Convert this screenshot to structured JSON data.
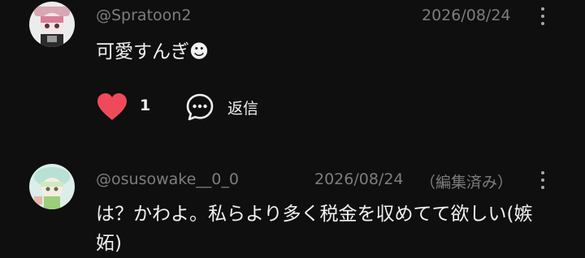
{
  "comments": [
    {
      "handle": "@Spratoon2",
      "date": "2026/08/24",
      "text": "可愛すんぎ☻",
      "like_icon": "heart-icon",
      "like_count": "1",
      "reply_icon": "speech-bubble-icon",
      "reply_label": "返信",
      "more_icon": "more-vertical-icon"
    },
    {
      "handle": "@osusowake__0_0",
      "date": "2026/08/24",
      "edited": "（編集済み）",
      "text": "は？かわよ。私らより多く税金を収めてて欲しい(嫉妬)",
      "more_icon": "more-vertical-icon"
    }
  ],
  "colors": {
    "background": "#0f0f0f",
    "text_primary": "#f1f1f1",
    "text_secondary": "#7d7d7d",
    "like_red": "#ef4a5a"
  }
}
